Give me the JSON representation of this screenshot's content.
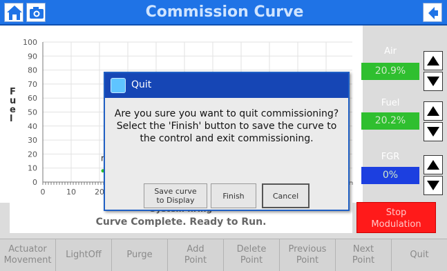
{
  "header": {
    "title": "Commission Curve",
    "home_icon": "home-icon",
    "camera_icon": "camera-icon",
    "back_icon": "back-arrow-icon"
  },
  "chart_data": {
    "type": "line",
    "ylabel": "Fuel",
    "y_ticks": [
      "100",
      "90",
      "80",
      "70",
      "60",
      "50",
      "40",
      "30",
      "20",
      "10",
      "0"
    ],
    "x_ticks": [
      "0",
      "10",
      "20"
    ],
    "ylim": [
      0,
      100
    ],
    "grid": true,
    "visible_label_fragment": "m"
  },
  "right_panel": {
    "air": {
      "label": "Air",
      "value": "20.9%"
    },
    "fuel": {
      "label": "Fuel",
      "value": "20.2%"
    },
    "fgr": {
      "label": "FGR",
      "value": "0%"
    }
  },
  "status": {
    "line1": "System firing",
    "line2": "Curve Complete. Ready to Run."
  },
  "stop_button": {
    "line1": "Stop",
    "line2": "Modulation"
  },
  "nav": [
    {
      "l1": "Actuator",
      "l2": "Movement"
    },
    {
      "l1": "LightOff",
      "l2": ""
    },
    {
      "l1": "Purge",
      "l2": ""
    },
    {
      "l1": "Add",
      "l2": "Point"
    },
    {
      "l1": "Delete",
      "l2": "Point"
    },
    {
      "l1": "Previous",
      "l2": "Point"
    },
    {
      "l1": "Next",
      "l2": "Point"
    },
    {
      "l1": "Quit",
      "l2": ""
    }
  ],
  "dialog": {
    "title": "Quit",
    "message": "Are you sure you want to quit commissioning? Select the 'Finish' button to save the curve to the control and exit commissioning.",
    "buttons": {
      "save_l1": "Save curve",
      "save_l2": "to Display",
      "finish": "Finish",
      "cancel": "Cancel"
    }
  },
  "colors": {
    "header": "#1f73e6",
    "readout_green": "#2fbf2f",
    "readout_blue": "#1c3fe0",
    "stop_red": "#ff1a1a",
    "dialog_title": "#1646b5"
  }
}
